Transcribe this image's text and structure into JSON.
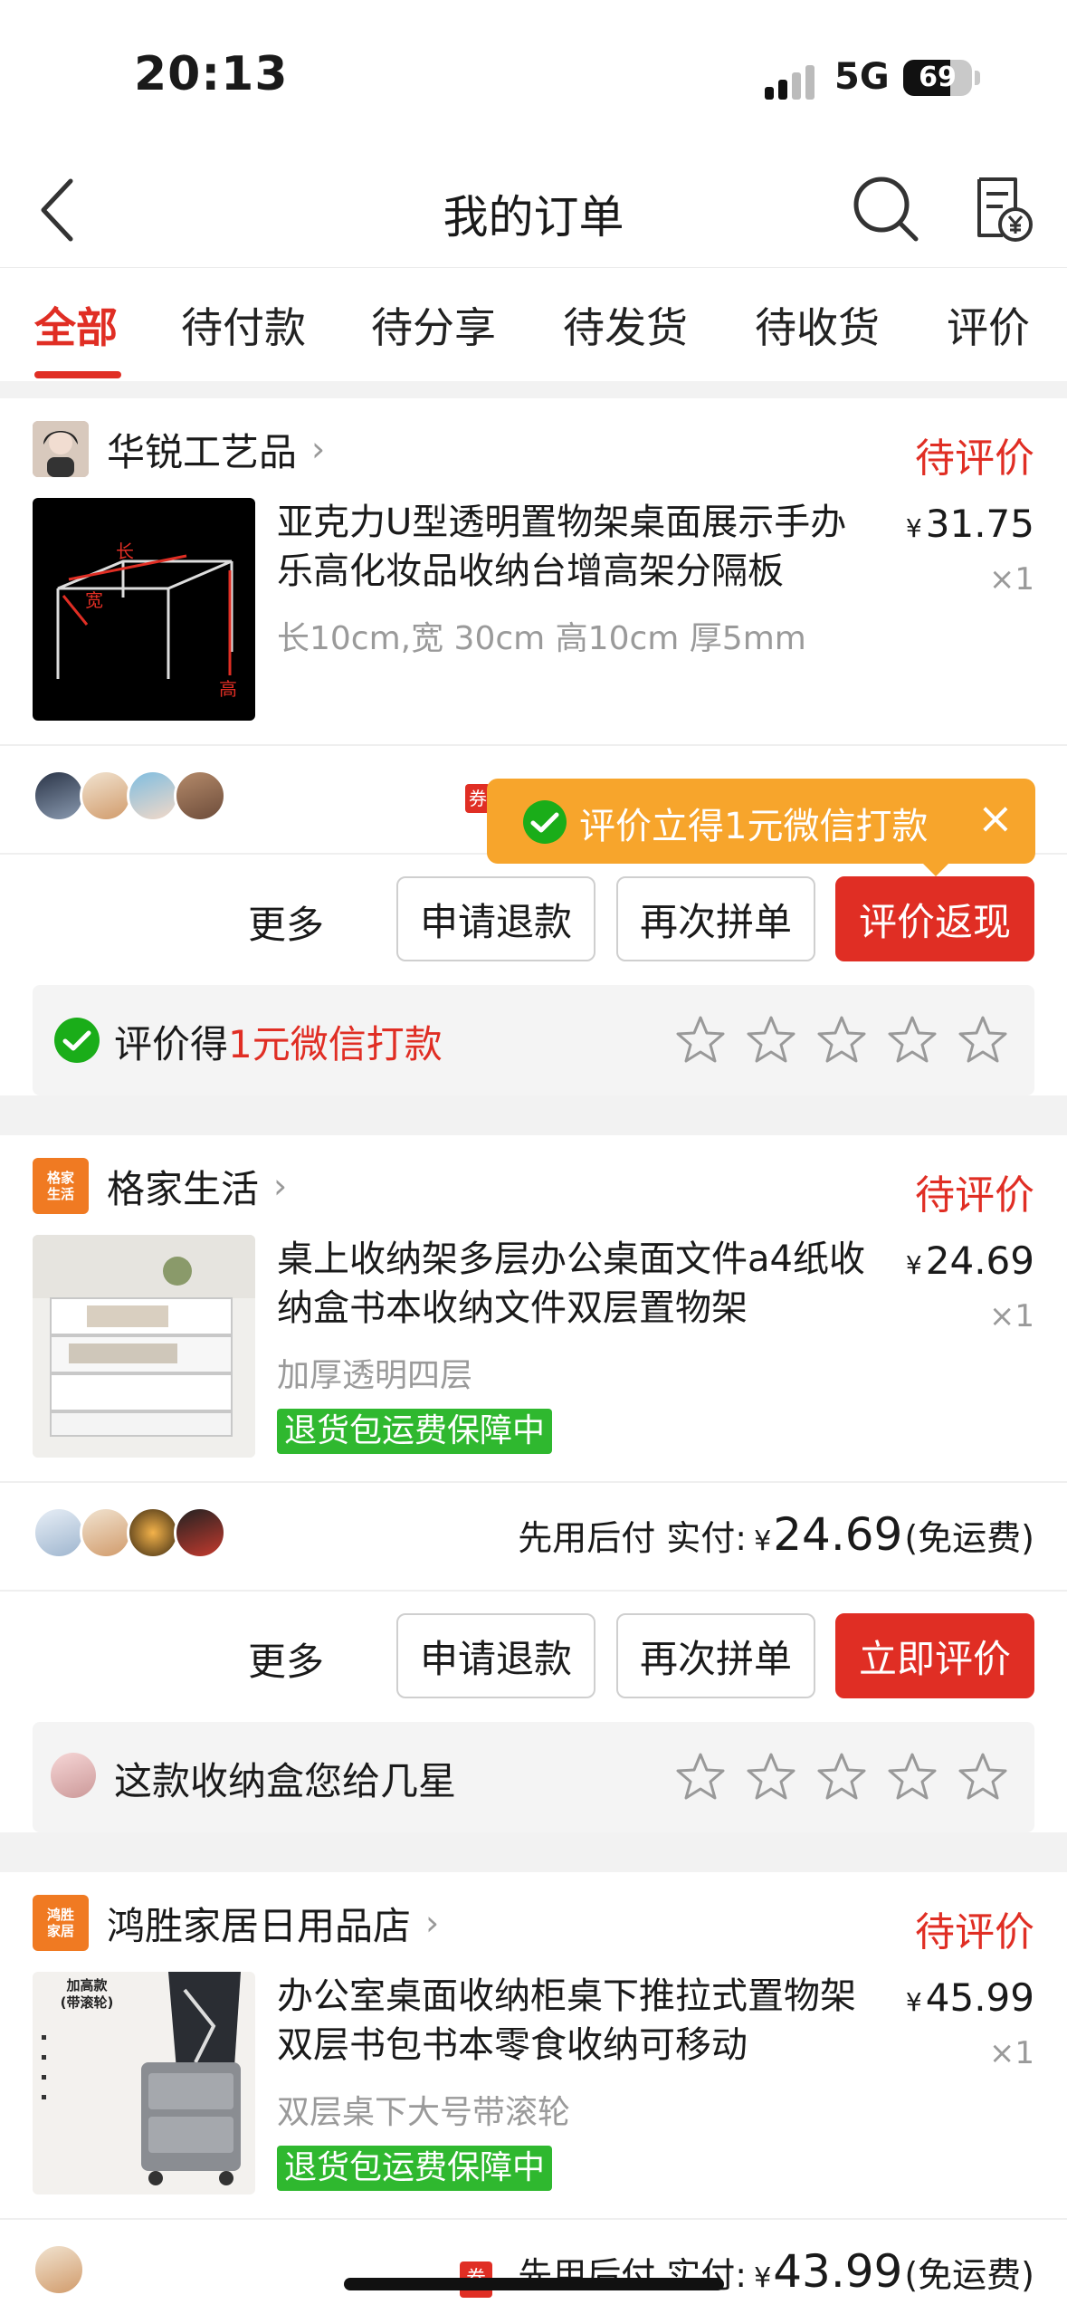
{
  "status_bar": {
    "time": "20:13",
    "network": "5G",
    "battery": "69",
    "battery_level": 0.69
  },
  "nav": {
    "title": "我的订单",
    "search_icon": "search-icon",
    "bill_icon": "bill-yen-icon"
  },
  "tabs": [
    {
      "label": "全部",
      "active": true
    },
    {
      "label": "待付款"
    },
    {
      "label": "待分享"
    },
    {
      "label": "待发货"
    },
    {
      "label": "待收货"
    },
    {
      "label": "评价"
    }
  ],
  "orders": [
    {
      "shop": "华锐工艺品",
      "status": "待评价",
      "product": "亚克力U型透明置物架桌面展示手办乐高化妆品收纳台增高架分隔板",
      "spec": "长10cm,宽 30cm 高10cm 厚5mm",
      "price": "31.75",
      "currency": "¥",
      "qty": "×1",
      "thumb_labels": {
        "length": "长",
        "width": "宽",
        "height": "高"
      },
      "tooltip": "评价立得1元微信打款",
      "coupon_tag": "券",
      "actions": {
        "more": "更多",
        "refund": "申请退款",
        "regroup": "再次拼单",
        "primary": "评价返现"
      },
      "rate_prompt": {
        "prefix": "评价得",
        "highlight": "1元微信打款"
      }
    },
    {
      "shop": "格家生活",
      "shop_logo_text": "格家\n生活",
      "status": "待评价",
      "product": "桌上收纳架多层办公桌面文件a4纸收纳盒书本收纳文件双层置物架",
      "spec": "加厚透明四层",
      "guarantee": "退货包运费保障中",
      "price": "24.69",
      "currency": "¥",
      "qty": "×1",
      "paid": {
        "prefix": "先用后付 实付:",
        "amount": "24.69",
        "note": "(免运费)"
      },
      "actions": {
        "more": "更多",
        "refund": "申请退款",
        "regroup": "再次拼单",
        "primary": "立即评价"
      },
      "rate_prompt": {
        "text": "这款收纳盒您给几星"
      }
    },
    {
      "shop": "鸿胜家居日用品店",
      "shop_logo_text": "鸿胜\n家居",
      "status": "待评价",
      "product": "办公室桌面收纳柜桌下推拉式置物架双层书包书本零食收纳可移动",
      "spec": "双层桌下大号带滚轮",
      "guarantee": "退货包运费保障中",
      "price": "45.99",
      "currency": "¥",
      "qty": "×1",
      "thumb_label": "加高款\n(带滚轮)",
      "coupon_tag": "券",
      "paid": {
        "prefix": "先用后付 实付:",
        "amount": "43.99",
        "note": "(免运费)"
      }
    }
  ],
  "colors": {
    "accent": "#e02e24",
    "green": "#2fb82f",
    "tooltip": "#f7a52c",
    "wechat": "#1aad19"
  }
}
